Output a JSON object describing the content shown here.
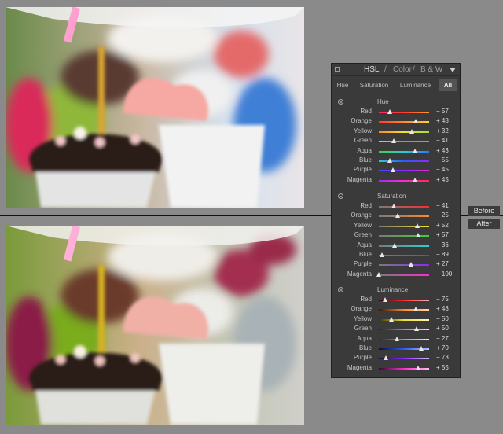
{
  "panel": {
    "title": "HSL",
    "sep1": "/",
    "color_label": "Color",
    "sep2": "/",
    "bw_label": "B & W"
  },
  "tabs": {
    "hue": "Hue",
    "saturation": "Saturation",
    "luminance": "Luminance",
    "all": "All"
  },
  "sections": [
    {
      "title": "Hue",
      "rows": [
        {
          "label": "Red",
          "value": "− 57",
          "amount": -57,
          "gradient": "#ff2a6e,#ff3b2a,#ff9a2a"
        },
        {
          "label": "Orange",
          "value": "+ 48",
          "amount": 48,
          "gradient": "#ff3a2a,#ff8a2a,#ffd02a"
        },
        {
          "label": "Yellow",
          "value": "+ 32",
          "amount": 32,
          "gradient": "#ff8a2a,#f4e12a,#9ae22a"
        },
        {
          "label": "Green",
          "value": "− 41",
          "amount": -41,
          "gradient": "#c8e02a,#3fcf3a,#2ad0a8"
        },
        {
          "label": "Aqua",
          "value": "+ 43",
          "amount": 43,
          "gradient": "#3fd03a,#2ad0d0,#2a7aff"
        },
        {
          "label": "Blue",
          "value": "− 55",
          "amount": -55,
          "gradient": "#2ad0c8,#2a5aff,#8a2aff"
        },
        {
          "label": "Purple",
          "value": "− 45",
          "amount": -45,
          "gradient": "#3a4aff,#8a2aff,#e02ad0"
        },
        {
          "label": "Magenta",
          "value": "+ 45",
          "amount": 45,
          "gradient": "#9a2aff,#ff2ad0,#ff2a5a"
        }
      ]
    },
    {
      "title": "Saturation",
      "rows": [
        {
          "label": "Red",
          "value": "− 41",
          "amount": -41,
          "gradient": "#7a7a7a,#ff2a2a"
        },
        {
          "label": "Orange",
          "value": "− 25",
          "amount": -25,
          "gradient": "#7a7a7a,#ff8a2a"
        },
        {
          "label": "Yellow",
          "value": "+ 52",
          "amount": 52,
          "gradient": "#7a7a7a,#f4e12a"
        },
        {
          "label": "Green",
          "value": "+ 57",
          "amount": 57,
          "gradient": "#7a7a7a,#3fcf3a"
        },
        {
          "label": "Aqua",
          "value": "− 36",
          "amount": -36,
          "gradient": "#7a7a7a,#2ad0d0"
        },
        {
          "label": "Blue",
          "value": "− 89",
          "amount": -89,
          "gradient": "#7a7a7a,#2a5aff"
        },
        {
          "label": "Purple",
          "value": "+ 27",
          "amount": 27,
          "gradient": "#7a7a7a,#8a2aff"
        },
        {
          "label": "Magenta",
          "value": "− 100",
          "amount": -100,
          "gradient": "#7a7a7a,#ff2ad0"
        }
      ]
    },
    {
      "title": "Luminance",
      "rows": [
        {
          "label": "Red",
          "value": "− 75",
          "amount": -75,
          "gradient": "#3a0808,#ff2a2a,#ffb0b0"
        },
        {
          "label": "Orange",
          "value": "+ 48",
          "amount": 48,
          "gradient": "#3a1a08,#ff8a2a,#ffd8b0"
        },
        {
          "label": "Yellow",
          "value": "− 50",
          "amount": -50,
          "gradient": "#3a3608,#f4e12a,#fff6b0"
        },
        {
          "label": "Green",
          "value": "+ 50",
          "amount": 50,
          "gradient": "#0a3a08,#3fcf3a,#c0ffb8"
        },
        {
          "label": "Aqua",
          "value": "− 27",
          "amount": -27,
          "gradient": "#083a3a,#2ad0d0,#b0ffff"
        },
        {
          "label": "Blue",
          "value": "+ 70",
          "amount": 70,
          "gradient": "#08103a,#2a5aff,#b0c4ff"
        },
        {
          "label": "Purple",
          "value": "− 73",
          "amount": -73,
          "gradient": "#1e083a,#8a2aff,#d8b8ff"
        },
        {
          "label": "Magenta",
          "value": "+ 55",
          "amount": 55,
          "gradient": "#3a0830,#ff2ad0,#ffb8f0"
        }
      ]
    }
  ],
  "view_labels": {
    "before": "Before",
    "after": "After"
  }
}
